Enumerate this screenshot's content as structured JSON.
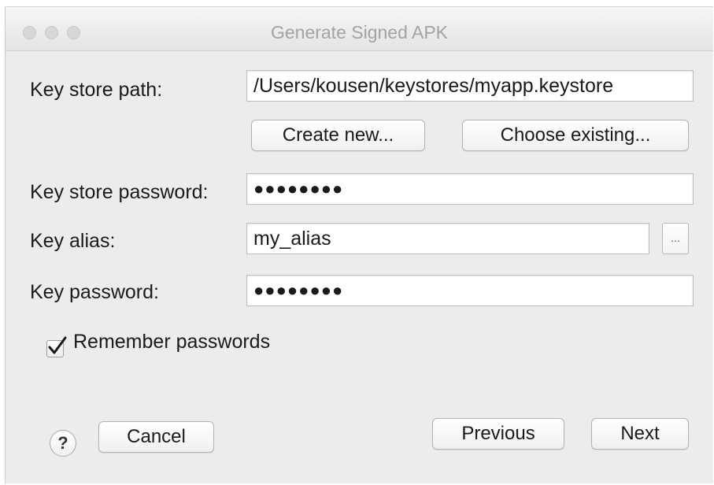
{
  "window": {
    "title": "Generate Signed APK"
  },
  "form": {
    "keystore_path_label": "Key store path:",
    "keystore_path_value": "/Users/kousen/keystores/myapp.keystore",
    "create_new_label": "Create new...",
    "choose_existing_label": "Choose existing...",
    "keystore_password_label": "Key store password:",
    "keystore_password_mask": "●●●●●●●●",
    "key_alias_label": "Key alias:",
    "key_alias_value": "my_alias",
    "alias_browse_label": "...",
    "key_password_label": "Key password:",
    "key_password_mask": "●●●●●●●●",
    "remember_label": "Remember passwords",
    "remember_checked": true
  },
  "footer": {
    "help_label": "?",
    "cancel_label": "Cancel",
    "previous_label": "Previous",
    "next_label": "Next"
  },
  "icons": {
    "window_controls": [
      "close-icon",
      "minimize-icon",
      "zoom-icon"
    ],
    "checkmark": "checkmark-icon",
    "help": "help-icon"
  },
  "colors": {
    "window_background": "#ececec",
    "title_text": "#a3a3a3"
  }
}
